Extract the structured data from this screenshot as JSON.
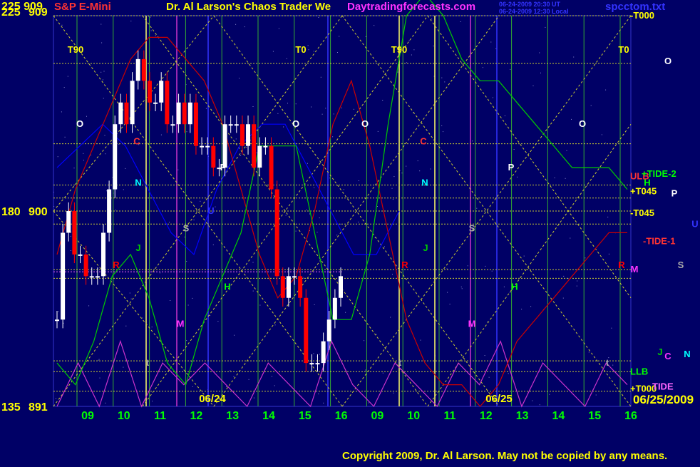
{
  "header": {
    "left_values": "225  909",
    "instrument": "S&P E-Mini",
    "title": "Dr. Al Larson's Chaos Trader We",
    "site": "Daytradingforecasts.com",
    "stamp1": "06-24-2009 20:30 UT",
    "stamp2": "06-24-2009 12:30 Local",
    "filename": "spcctom.txt"
  },
  "footer": {
    "copyright": "Copyright 2009, Dr. Al Larson. May not be copied by any means."
  },
  "colors": {
    "background": "#000066",
    "price_up": "#ffffff",
    "price_down": "#ff0000",
    "axis_text": "#ffff00",
    "time_text": "#00ff00",
    "red_curve": "#cc0000",
    "green_curve": "#00cc00",
    "blue_curve": "#0000ff",
    "magenta_curve": "#cc33cc",
    "grid_yellow": "#cccc33",
    "grid_green": "#33aa33"
  },
  "chart_data": {
    "type": "bar",
    "title": "S&P E-Mini",
    "left_axis": [
      {
        "label": "225",
        "value": 225
      },
      {
        "label": "180",
        "value": 180
      },
      {
        "label": "135",
        "value": 135
      }
    ],
    "price_axis": [
      {
        "label": "909",
        "value": 909
      },
      {
        "label": "900",
        "value": 900
      },
      {
        "label": "891",
        "value": 891
      }
    ],
    "ylim": [
      891,
      909
    ],
    "hours": [
      "09",
      "10",
      "11",
      "12",
      "13",
      "14",
      "15",
      "16",
      "09",
      "10",
      "11",
      "12",
      "13",
      "14",
      "15",
      "16"
    ],
    "date_labels": [
      "06/24",
      "06/25"
    ],
    "end_date": "06/25/2009",
    "top_labels": [
      "T90",
      "T0",
      "T90",
      "T0"
    ],
    "right_labels": [
      {
        "text": "-T000",
        "price": 909.0,
        "color": "#ffff00"
      },
      {
        "text": "ULB",
        "price": 901.6,
        "color": "#ff3333"
      },
      {
        "text": "+TIDE-2",
        "price": 901.7,
        "color": "#00ff00"
      },
      {
        "text": "+T045",
        "price": 900.9,
        "color": "#ffff00"
      },
      {
        "text": "-T045",
        "price": 899.9,
        "color": "#ffff00"
      },
      {
        "text": "-TIDE-1",
        "price": 898.6,
        "color": "#ff3333"
      },
      {
        "text": "LLB",
        "price": 892.6,
        "color": "#00ff00"
      },
      {
        "text": "+T000",
        "price": 891.8,
        "color": "#ffff00"
      },
      {
        "text": "TIDE",
        "price": 891.9,
        "color": "#ff66ff"
      }
    ],
    "planets": [
      {
        "text": "O",
        "x": 112,
        "price": 904.0,
        "color": "#ffffff"
      },
      {
        "text": "O",
        "x": 415,
        "price": 904.0,
        "color": "#ffffff"
      },
      {
        "text": "O",
        "x": 512,
        "price": 904.0,
        "color": "#ffffff"
      },
      {
        "text": "O",
        "x": 817,
        "price": 904.0,
        "color": "#ffffff"
      },
      {
        "text": "O",
        "x": 937,
        "price": 906.9,
        "color": "#ffffff"
      },
      {
        "text": "P",
        "x": 313,
        "price": 902.0,
        "color": "#ffffff"
      },
      {
        "text": "P",
        "x": 717,
        "price": 902.0,
        "color": "#ffffff"
      },
      {
        "text": "P",
        "x": 946,
        "price": 900.8,
        "color": "#ffffff"
      },
      {
        "text": "N",
        "x": 194,
        "price": 901.3,
        "color": "#00ffff"
      },
      {
        "text": "N",
        "x": 596,
        "price": 901.3,
        "color": "#00ffff"
      },
      {
        "text": "N",
        "x": 964,
        "price": 893.4,
        "color": "#00ffff"
      },
      {
        "text": "C",
        "x": 192,
        "price": 903.2,
        "color": "#ff3333"
      },
      {
        "text": "C",
        "x": 594,
        "price": 903.2,
        "color": "#ff3333"
      },
      {
        "text": "C",
        "x": 937,
        "price": 893.3,
        "color": "#ff33ff"
      },
      {
        "text": "U",
        "x": 296,
        "price": 900.0,
        "color": "#3333ff"
      },
      {
        "text": "U",
        "x": 975,
        "price": 899.4,
        "color": "#3333ff"
      },
      {
        "text": "S",
        "x": 261,
        "price": 899.2,
        "color": "#aaaaaa"
      },
      {
        "text": "S",
        "x": 662,
        "price": 899.2,
        "color": "#aaaaaa"
      },
      {
        "text": "S",
        "x": 955,
        "price": 897.5,
        "color": "#aaaaaa"
      },
      {
        "text": "J",
        "x": 194,
        "price": 898.3,
        "color": "#00cc00"
      },
      {
        "text": "J",
        "x": 597,
        "price": 898.3,
        "color": "#00cc00"
      },
      {
        "text": "J",
        "x": 926,
        "price": 893.5,
        "color": "#00cc00"
      },
      {
        "text": "R",
        "x": 163,
        "price": 897.5,
        "color": "#ff0000"
      },
      {
        "text": "R",
        "x": 568,
        "price": 897.5,
        "color": "#ff0000"
      },
      {
        "text": "R",
        "x": 872,
        "price": 897.5,
        "color": "#ff0000"
      },
      {
        "text": "H",
        "x": 319,
        "price": 896.5,
        "color": "#00ff00"
      },
      {
        "text": "H",
        "x": 722,
        "price": 896.5,
        "color": "#00ff00"
      },
      {
        "text": "H",
        "x": 908,
        "price": 901.3,
        "color": "#00ff00"
      },
      {
        "text": "M",
        "x": 253,
        "price": 894.8,
        "color": "#ff33ff"
      },
      {
        "text": "M",
        "x": 662,
        "price": 894.8,
        "color": "#ff33ff"
      },
      {
        "text": "M",
        "x": 890,
        "price": 897.3,
        "color": "#ff33ff"
      },
      {
        "text": "t",
        "x": 207,
        "price": 893.0,
        "color": "#aaaaaa"
      },
      {
        "text": "t",
        "x": 561,
        "price": 893.0,
        "color": "#aaaaaa"
      },
      {
        "text": "t",
        "x": 852,
        "price": 893.0,
        "color": "#aaaaaa"
      }
    ],
    "series": [
      {
        "name": "price_closes",
        "values": [
          895,
          899,
          900,
          898,
          898,
          897,
          897,
          897,
          899,
          901,
          904,
          905,
          904,
          906,
          907,
          906,
          905,
          905,
          906,
          904,
          904,
          905,
          904,
          905,
          903,
          903,
          903,
          902,
          902,
          904,
          904,
          904,
          903,
          904,
          902,
          903,
          903,
          901,
          897,
          896,
          897,
          897,
          896,
          893,
          893,
          893,
          894,
          895,
          896,
          897
        ]
      },
      {
        "name": "red_flux",
        "values": [
          898,
          901,
          903,
          905,
          907,
          908,
          908,
          907,
          906,
          904,
          901,
          898,
          896,
          897,
          900,
          904,
          906,
          903,
          899,
          895,
          893,
          892,
          892,
          891,
          892,
          894,
          895,
          896,
          897,
          898,
          899,
          899
        ]
      },
      {
        "name": "green_flux",
        "values": [
          893,
          892,
          894,
          897,
          898,
          896,
          893,
          892,
          895,
          897,
          899,
          903,
          903,
          903,
          899,
          895,
          895,
          898,
          904,
          909,
          910,
          909,
          907,
          906,
          906,
          905,
          904,
          903,
          902,
          902,
          902,
          901
        ]
      },
      {
        "name": "blue_flux",
        "values": [
          902,
          903,
          904,
          903,
          901,
          899,
          898,
          901,
          903,
          904,
          904,
          902,
          900,
          898,
          898,
          900
        ]
      },
      {
        "name": "magenta_flux",
        "values": [
          891,
          893,
          891,
          894,
          891,
          893,
          892,
          893,
          892,
          891,
          893,
          892,
          891,
          894,
          892,
          891,
          893,
          892,
          891,
          893,
          892,
          894,
          891,
          893,
          892,
          891,
          893,
          892
        ]
      }
    ]
  }
}
